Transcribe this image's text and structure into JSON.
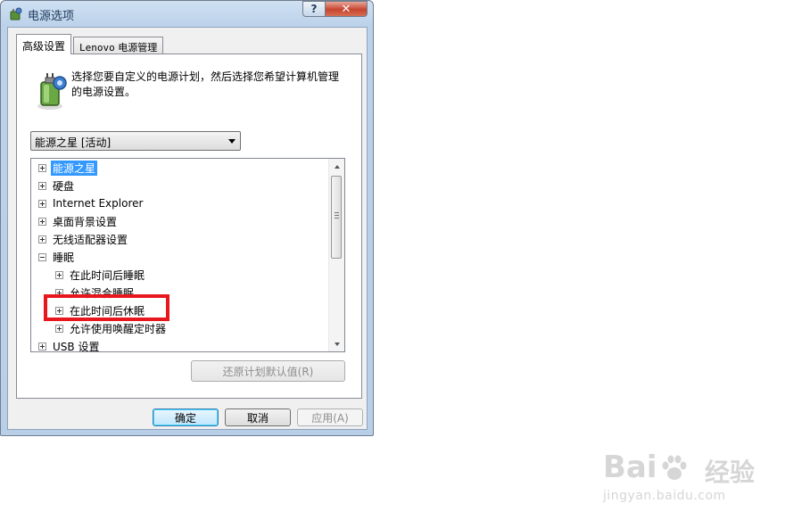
{
  "window": {
    "title": "电源选项",
    "help_label": "?",
    "close_label": "✕",
    "icon": "power-options-icon"
  },
  "tabs": [
    {
      "label": "高级设置",
      "active": true
    },
    {
      "label_mono": "Lenovo",
      "label_rest": " 电源管理",
      "active": false
    }
  ],
  "description": "选择您要自定义的电源计划，然后选择您希望计算机管理的电源设置。",
  "plan_select": {
    "value": "能源之星 [活动]"
  },
  "tree": {
    "items": [
      {
        "label": "能源之星",
        "level": 0,
        "expander": "plus",
        "selected": true
      },
      {
        "label": "硬盘",
        "level": 0,
        "expander": "plus"
      },
      {
        "label": "Internet Explorer",
        "level": 0,
        "expander": "plus"
      },
      {
        "label": "桌面背景设置",
        "level": 0,
        "expander": "plus"
      },
      {
        "label": "无线适配器设置",
        "level": 0,
        "expander": "plus"
      },
      {
        "label": "睡眠",
        "level": 0,
        "expander": "minus"
      },
      {
        "label": "在此时间后睡眠",
        "level": 1,
        "expander": "plus"
      },
      {
        "label": "允许混合睡眠",
        "level": 1,
        "expander": "plus"
      },
      {
        "label": "在此时间后休眠",
        "level": 1,
        "expander": "plus"
      },
      {
        "label": "允许使用唤醒定时器",
        "level": 1,
        "expander": "plus"
      },
      {
        "label": "USB 设置",
        "level": 0,
        "expander": "plus"
      }
    ]
  },
  "buttons": {
    "restore": "还原计划默认值(R)",
    "ok": "确定",
    "cancel": "取消",
    "apply": "应用(A)"
  },
  "watermark": {
    "brand": "Bai",
    "brand2": "经验",
    "url": "jingyan.baidu.com"
  },
  "colors": {
    "selection": "#3399ff",
    "highlight_box": "#e8161d",
    "close_button": "#c7442f"
  }
}
